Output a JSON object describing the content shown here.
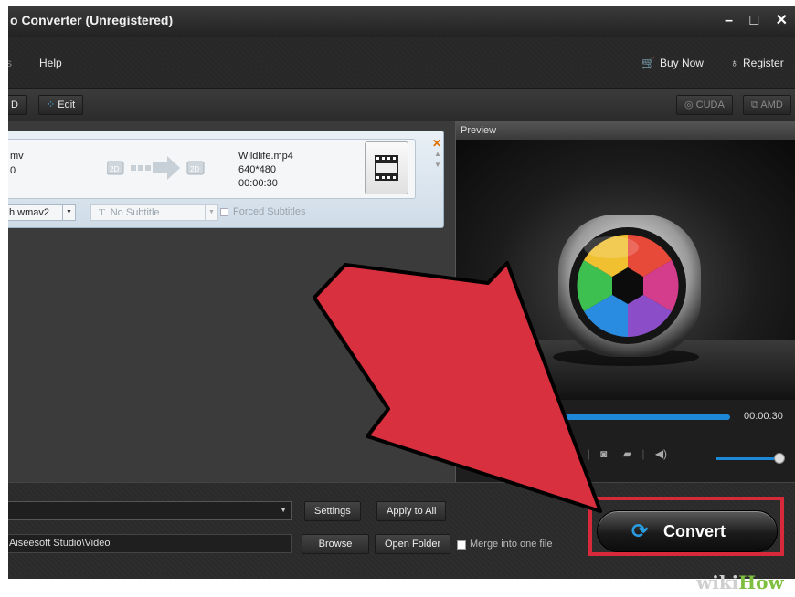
{
  "window": {
    "title": "o Converter (Unregistered)",
    "controls": [
      "–",
      "□",
      "✕"
    ]
  },
  "menu": {
    "left_stub": "s",
    "help": "Help",
    "buy_now": "Buy Now",
    "register": "Register"
  },
  "toolbar": {
    "left_stub": "D",
    "edit": "Edit",
    "cuda": "CUDA",
    "amd": "AMD"
  },
  "file": {
    "source_name": "mv",
    "source_duration": "0",
    "src_badge": "2D",
    "dst_badge": "2D",
    "output_name": "Wildlife.mp4",
    "output_resolution": "640*480",
    "output_duration": "00:00:30",
    "audio_track": "h wmav2",
    "subtitle": "No Subtitle",
    "forced_subtitles": "Forced Subtitles"
  },
  "preview": {
    "header": "Preview",
    "time": "00:00:30",
    "progress": 1.0,
    "volume": 1.0
  },
  "bottom": {
    "settings": "Settings",
    "apply_to_all": "Apply to All",
    "destination": "Aiseesoft Studio\\Video",
    "browse": "Browse",
    "open_folder": "Open Folder",
    "merge": "Merge into one file",
    "convert": "Convert"
  },
  "watermark": {
    "part1": "wiki",
    "part2": "How"
  },
  "colors": {
    "accent_blue": "#1e88d8",
    "highlight_red": "#d62a3a",
    "arrow_fill": "#d8303e"
  }
}
